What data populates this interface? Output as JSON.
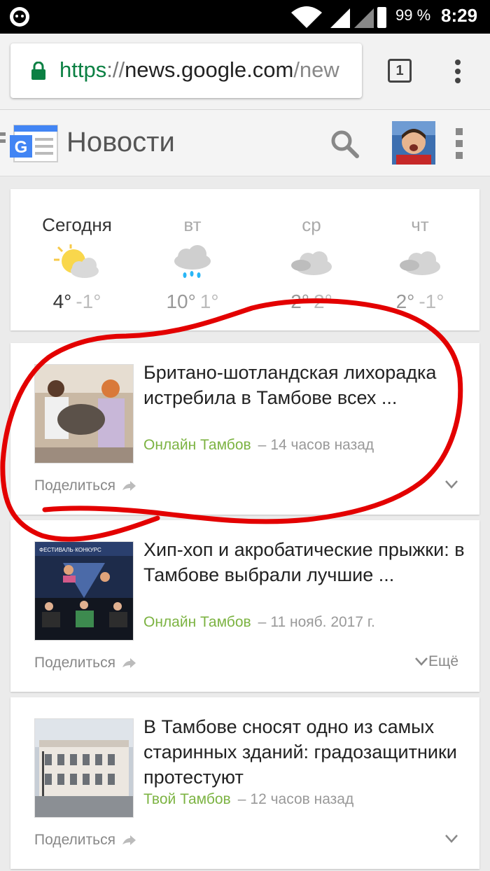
{
  "status_bar": {
    "battery_percent": "99 %",
    "time": "8:29"
  },
  "browser": {
    "url_scheme": "https",
    "url_separator": "://",
    "url_host": "news.google.com",
    "url_path": "/new",
    "tab_count": "1"
  },
  "app": {
    "title": "Новости"
  },
  "weather": {
    "days": [
      {
        "name": "Сегодня",
        "icon": "partly-sunny-icon",
        "high": "4°",
        "low": "-1°"
      },
      {
        "name": "вт",
        "icon": "rain-cloud-icon",
        "high": "10°",
        "low": "1°"
      },
      {
        "name": "ср",
        "icon": "cloudy-icon",
        "high": "2°",
        "low": "2°"
      },
      {
        "name": "чт",
        "icon": "cloudy-icon",
        "high": "2°",
        "low": "-1°"
      }
    ]
  },
  "articles": [
    {
      "title": "Британо-шотландская лихорадка истребила в Тамбове всех ...",
      "source": "Онлайн Тамбов",
      "dash": "–",
      "time": "14 часов назад",
      "share": "Поделиться",
      "more": ""
    },
    {
      "title": "Хип-хоп и акробатические прыжки: в Тамбове выбрали лучшие ...",
      "source": "Онлайн Тамбов",
      "dash": "–",
      "time": "11 нояб. 2017 г.",
      "share": "Поделиться",
      "more": "Ещё"
    },
    {
      "title": "В Тамбове сносят одно из самых старинных зданий: градозащитники протестуют",
      "source": "Твой Тамбов",
      "dash": "–",
      "time": "12 часов назад",
      "share": "Поделиться",
      "more": ""
    }
  ],
  "colors": {
    "source_green": "#7cb342",
    "annotation_red": "#e30000",
    "url_green": "#0b8043"
  }
}
